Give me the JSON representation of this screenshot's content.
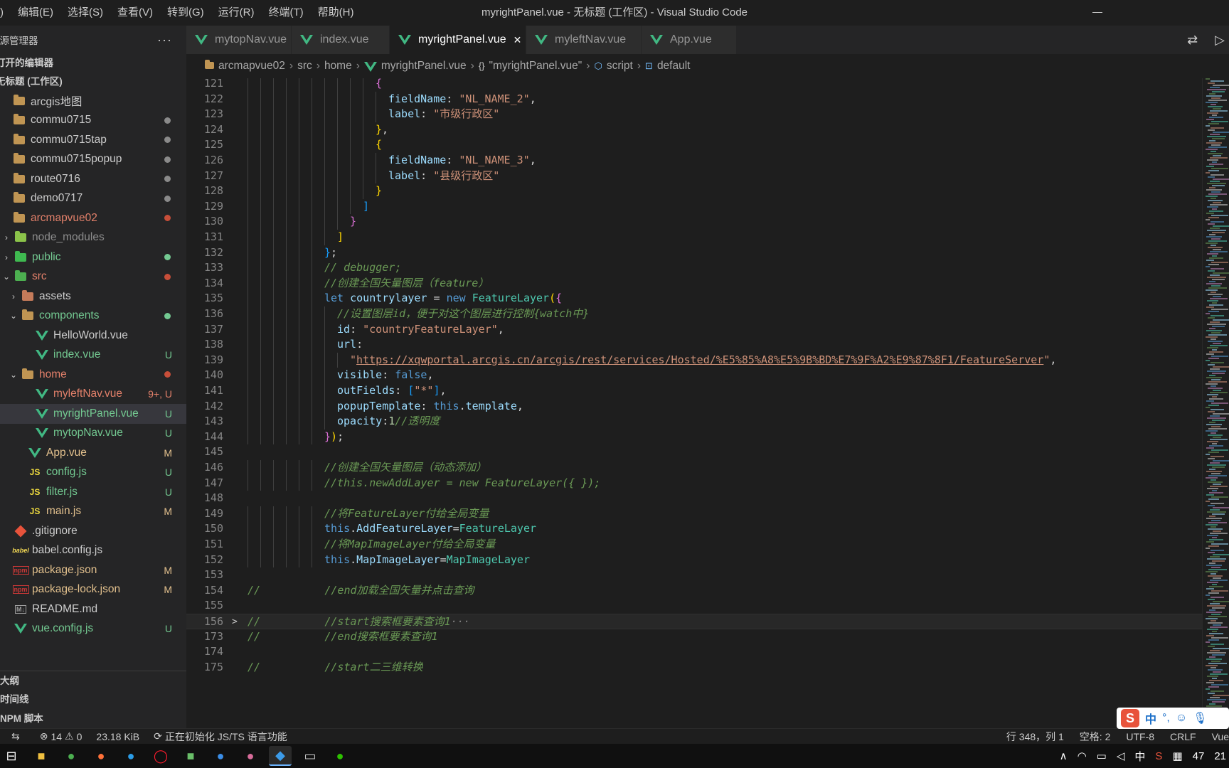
{
  "menubar": {
    "items": [
      ")",
      "编辑(E)",
      "选择(S)",
      "查看(V)",
      "转到(G)",
      "运行(R)",
      "终端(T)",
      "帮助(H)"
    ]
  },
  "window": {
    "title": "myrightPanel.vue - 无标题 (工作区) - Visual Studio Code"
  },
  "sidebar": {
    "title": "资源管理器",
    "more": "···",
    "open_editors": "打开的编辑器",
    "workspace": "无标题 (工作区)",
    "outline": "大纲",
    "timeline": "时间线",
    "npm": "NPM 脚本",
    "tree": [
      {
        "label": "arcgis地图",
        "type": "folder",
        "indent": 0,
        "color": "#cccccc",
        "dot": ""
      },
      {
        "label": "commu0715",
        "type": "folder",
        "indent": 0,
        "color": "#cccccc",
        "dot": "#8a8a8a"
      },
      {
        "label": "commu0715tap",
        "type": "folder",
        "indent": 0,
        "color": "#cccccc",
        "dot": "#8a8a8a"
      },
      {
        "label": "commu0715popup",
        "type": "folder",
        "indent": 0,
        "color": "#cccccc",
        "dot": "#8a8a8a"
      },
      {
        "label": "route0716",
        "type": "folder",
        "indent": 0,
        "color": "#cccccc",
        "dot": "#8a8a8a"
      },
      {
        "label": "demo0717",
        "type": "folder",
        "indent": 0,
        "color": "#cccccc",
        "dot": "#8a8a8a"
      },
      {
        "label": "arcmapvue02",
        "type": "folder",
        "indent": 0,
        "color": "#e2806a",
        "dot": "#c74e39"
      },
      {
        "label": "node_modules",
        "type": "folder-closed",
        "indent": 1,
        "color": "#8c8c8c",
        "dot": ""
      },
      {
        "label": "public",
        "type": "folder-closed",
        "indent": 1,
        "color": "#73c991",
        "dot": "#73c991"
      },
      {
        "label": "src",
        "type": "folder-open",
        "indent": 1,
        "color": "#e2806a",
        "dot": "#c74e39"
      },
      {
        "label": "assets",
        "type": "folder-closed",
        "indent": 2,
        "color": "#cccccc",
        "dot": ""
      },
      {
        "label": "components",
        "type": "folder-open",
        "indent": 2,
        "color": "#73c991",
        "dot": "#73c991"
      },
      {
        "label": "HelloWorld.vue",
        "type": "vue",
        "indent": 3,
        "color": "#cccccc",
        "badge": ""
      },
      {
        "label": "index.vue",
        "type": "vue",
        "indent": 3,
        "color": "#73c991",
        "badge": "U"
      },
      {
        "label": "home",
        "type": "folder-open",
        "indent": 2,
        "color": "#e2806a",
        "dot": "#c74e39"
      },
      {
        "label": "myleftNav.vue",
        "type": "vue",
        "indent": 3,
        "color": "#e2806a",
        "badge": "9+, U"
      },
      {
        "label": "myrightPanel.vue",
        "type": "vue",
        "indent": 3,
        "color": "#73c991",
        "badge": "U",
        "selected": true
      },
      {
        "label": "mytopNav.vue",
        "type": "vue",
        "indent": 3,
        "color": "#73c991",
        "badge": "U"
      },
      {
        "label": "App.vue",
        "type": "vue",
        "indent": 2,
        "color": "#e2c08d",
        "badge": "M"
      },
      {
        "label": "config.js",
        "type": "js",
        "indent": 2,
        "color": "#73c991",
        "badge": "U"
      },
      {
        "label": "filter.js",
        "type": "js",
        "indent": 2,
        "color": "#73c991",
        "badge": "U"
      },
      {
        "label": "main.js",
        "type": "js",
        "indent": 2,
        "color": "#e2c08d",
        "badge": "M"
      },
      {
        "label": ".gitignore",
        "type": "git",
        "indent": 1,
        "color": "#cccccc",
        "badge": ""
      },
      {
        "label": "babel.config.js",
        "type": "babel",
        "indent": 1,
        "color": "#cccccc",
        "badge": ""
      },
      {
        "label": "package.json",
        "type": "json",
        "indent": 1,
        "color": "#e2c08d",
        "badge": "M"
      },
      {
        "label": "package-lock.json",
        "type": "json",
        "indent": 1,
        "color": "#e2c08d",
        "badge": "M"
      },
      {
        "label": "README.md",
        "type": "md",
        "indent": 1,
        "color": "#cccccc",
        "badge": ""
      },
      {
        "label": "vue.config.js",
        "type": "vue",
        "indent": 1,
        "color": "#73c991",
        "badge": "U"
      }
    ]
  },
  "tabs": [
    {
      "label": "mytopNav.vue",
      "active": false
    },
    {
      "label": "index.vue",
      "active": false
    },
    {
      "label": "myrightPanel.vue",
      "active": true
    },
    {
      "label": "myleftNav.vue",
      "active": false
    },
    {
      "label": "App.vue",
      "active": false
    }
  ],
  "breadcrumb": [
    "arcmapvue02",
    "src",
    "home",
    "myrightPanel.vue",
    "\"myrightPanel.vue\"",
    "script",
    "default"
  ],
  "editor": {
    "current_line": "156",
    "lines": [
      {
        "n": "121",
        "indent": 10,
        "tokens": [
          [
            "{",
            "t-b2"
          ]
        ]
      },
      {
        "n": "122",
        "indent": 11,
        "tokens": [
          [
            "fieldName",
            "t-prop"
          ],
          [
            ": ",
            "t-punc"
          ],
          [
            "\"NL_NAME_2\"",
            "t-str"
          ],
          [
            ",",
            "t-punc"
          ]
        ]
      },
      {
        "n": "123",
        "indent": 11,
        "tokens": [
          [
            "label",
            "t-prop"
          ],
          [
            ": ",
            "t-punc"
          ],
          [
            "\"市级行政区\"",
            "t-str"
          ]
        ]
      },
      {
        "n": "124",
        "indent": 10,
        "tokens": [
          [
            "}",
            "t-b1"
          ],
          [
            ",",
            "t-punc"
          ]
        ]
      },
      {
        "n": "125",
        "indent": 10,
        "tokens": [
          [
            "{",
            "t-b1"
          ]
        ]
      },
      {
        "n": "126",
        "indent": 11,
        "tokens": [
          [
            "fieldName",
            "t-prop"
          ],
          [
            ": ",
            "t-punc"
          ],
          [
            "\"NL_NAME_3\"",
            "t-str"
          ],
          [
            ",",
            "t-punc"
          ]
        ]
      },
      {
        "n": "127",
        "indent": 11,
        "tokens": [
          [
            "label",
            "t-prop"
          ],
          [
            ": ",
            "t-punc"
          ],
          [
            "\"县级行政区\"",
            "t-str"
          ]
        ]
      },
      {
        "n": "128",
        "indent": 10,
        "tokens": [
          [
            "}",
            "t-b1"
          ]
        ]
      },
      {
        "n": "129",
        "indent": 9,
        "tokens": [
          [
            "]",
            "t-b3"
          ]
        ]
      },
      {
        "n": "130",
        "indent": 8,
        "tokens": [
          [
            "}",
            "t-b2"
          ]
        ]
      },
      {
        "n": "131",
        "indent": 7,
        "tokens": [
          [
            "]",
            "t-b1"
          ]
        ]
      },
      {
        "n": "132",
        "indent": 6,
        "tokens": [
          [
            "}",
            "t-b3"
          ],
          [
            ";",
            "t-punc"
          ]
        ]
      },
      {
        "n": "133",
        "indent": 6,
        "tokens": [
          [
            "// debugger;",
            "t-cmt"
          ]
        ]
      },
      {
        "n": "134",
        "indent": 6,
        "tokens": [
          [
            "//创建全国矢量图层（feature）",
            "t-cmt"
          ]
        ]
      },
      {
        "n": "135",
        "indent": 6,
        "tokens": [
          [
            "let ",
            "t-kw"
          ],
          [
            "countrylayer",
            "t-prop"
          ],
          [
            " = ",
            "t-punc"
          ],
          [
            "new ",
            "t-kw"
          ],
          [
            "FeatureLayer",
            "t-cls"
          ],
          [
            "(",
            "t-b1"
          ],
          [
            "{",
            "t-b2"
          ]
        ]
      },
      {
        "n": "136",
        "indent": 7,
        "tokens": [
          [
            "//设置图层id，便于对这个图层进行控制{watch中}",
            "t-cmt"
          ]
        ]
      },
      {
        "n": "137",
        "indent": 7,
        "tokens": [
          [
            "id",
            "t-prop"
          ],
          [
            ": ",
            "t-punc"
          ],
          [
            "\"countryFeatureLayer\"",
            "t-str"
          ],
          [
            ",",
            "t-punc"
          ]
        ]
      },
      {
        "n": "138",
        "indent": 7,
        "tokens": [
          [
            "url",
            "t-prop"
          ],
          [
            ":",
            "t-punc"
          ]
        ]
      },
      {
        "n": "139",
        "indent": 8,
        "tokens": [
          [
            "\"",
            "t-str"
          ],
          [
            "https://xqwportal.arcgis.cn/arcgis/rest/services/Hosted/%E5%85%A8%E5%9B%BD%E7%9F%A2%E9%87%8F1/FeatureServer",
            "t-link"
          ],
          [
            "\"",
            "t-str"
          ],
          [
            ",",
            "t-punc"
          ]
        ]
      },
      {
        "n": "140",
        "indent": 7,
        "tokens": [
          [
            "visible",
            "t-prop"
          ],
          [
            ": ",
            "t-punc"
          ],
          [
            "false",
            "t-kw"
          ],
          [
            ",",
            "t-punc"
          ]
        ]
      },
      {
        "n": "141",
        "indent": 7,
        "tokens": [
          [
            "outFields",
            "t-prop"
          ],
          [
            ": ",
            "t-punc"
          ],
          [
            "[",
            "t-b3"
          ],
          [
            "\"*\"",
            "t-str"
          ],
          [
            "]",
            "t-b3"
          ],
          [
            ",",
            "t-punc"
          ]
        ]
      },
      {
        "n": "142",
        "indent": 7,
        "tokens": [
          [
            "popupTemplate",
            "t-prop"
          ],
          [
            ": ",
            "t-punc"
          ],
          [
            "this",
            "t-this"
          ],
          [
            ".",
            "t-punc"
          ],
          [
            "template",
            "t-prop"
          ],
          [
            ",",
            "t-punc"
          ]
        ]
      },
      {
        "n": "143",
        "indent": 7,
        "tokens": [
          [
            "opacity",
            "t-prop"
          ],
          [
            ":",
            "t-punc"
          ],
          [
            "1",
            "t-num"
          ],
          [
            "//透明度",
            "t-cmt"
          ]
        ]
      },
      {
        "n": "144",
        "indent": 6,
        "tokens": [
          [
            "}",
            "t-b2"
          ],
          [
            ")",
            "t-b1"
          ],
          [
            ";",
            "t-punc"
          ]
        ]
      },
      {
        "n": "145",
        "indent": 0,
        "tokens": []
      },
      {
        "n": "146",
        "indent": 6,
        "tokens": [
          [
            "//创建全国矢量图层（动态添加）",
            "t-cmt"
          ]
        ]
      },
      {
        "n": "147",
        "indent": 6,
        "tokens": [
          [
            "//this.newAddLayer = new FeatureLayer({ });",
            "t-cmt"
          ]
        ]
      },
      {
        "n": "148",
        "indent": 0,
        "tokens": []
      },
      {
        "n": "149",
        "indent": 6,
        "tokens": [
          [
            "//将FeatureLayer付给全局变量",
            "t-cmt"
          ]
        ]
      },
      {
        "n": "150",
        "indent": 6,
        "tokens": [
          [
            "this",
            "t-this"
          ],
          [
            ".",
            "t-punc"
          ],
          [
            "AddFeatureLayer",
            "t-prop"
          ],
          [
            "=",
            "t-punc"
          ],
          [
            "FeatureLayer",
            "t-cls"
          ]
        ]
      },
      {
        "n": "151",
        "indent": 6,
        "tokens": [
          [
            "//将MapImageLayer付给全局变量",
            "t-cmt"
          ]
        ]
      },
      {
        "n": "152",
        "indent": 6,
        "tokens": [
          [
            "this",
            "t-this"
          ],
          [
            ".",
            "t-punc"
          ],
          [
            "MapImageLayer",
            "t-prop"
          ],
          [
            "=",
            "t-punc"
          ],
          [
            "MapImageLayer",
            "t-cls"
          ]
        ]
      },
      {
        "n": "153",
        "indent": 0,
        "tokens": []
      },
      {
        "n": "154",
        "indent": 0,
        "tokens": [
          [
            "//          //end加载全国矢量并点击查询",
            "t-cmt"
          ]
        ]
      },
      {
        "n": "155",
        "indent": 0,
        "tokens": []
      },
      {
        "n": "156",
        "indent": 0,
        "fold": ">",
        "tokens": [
          [
            "//          //start搜索框要素查询1",
            "t-cmt"
          ],
          [
            "···",
            "t-dim"
          ]
        ]
      },
      {
        "n": "173",
        "indent": 0,
        "tokens": [
          [
            "//          //end搜索框要素查询1",
            "t-cmt"
          ]
        ]
      },
      {
        "n": "174",
        "indent": 0,
        "tokens": []
      },
      {
        "n": "175",
        "indent": 0,
        "tokens": [
          [
            "//          //start二三维转换",
            "t-cmt"
          ]
        ]
      }
    ]
  },
  "statusbar": {
    "errors": "14",
    "warnings": "0",
    "size": "23.18 KiB",
    "task": "正在初始化 JS/TS 语言功能",
    "position": "行 348，列 1",
    "spaces": "空格: 2",
    "encoding": "UTF-8",
    "eol": "CRLF",
    "language": "Vue"
  },
  "ime": {
    "logo": "S",
    "mode": "中",
    "punct": "°,"
  },
  "taskbar": {
    "tray_lang": "中",
    "tray_num": "47",
    "clock": "21"
  }
}
